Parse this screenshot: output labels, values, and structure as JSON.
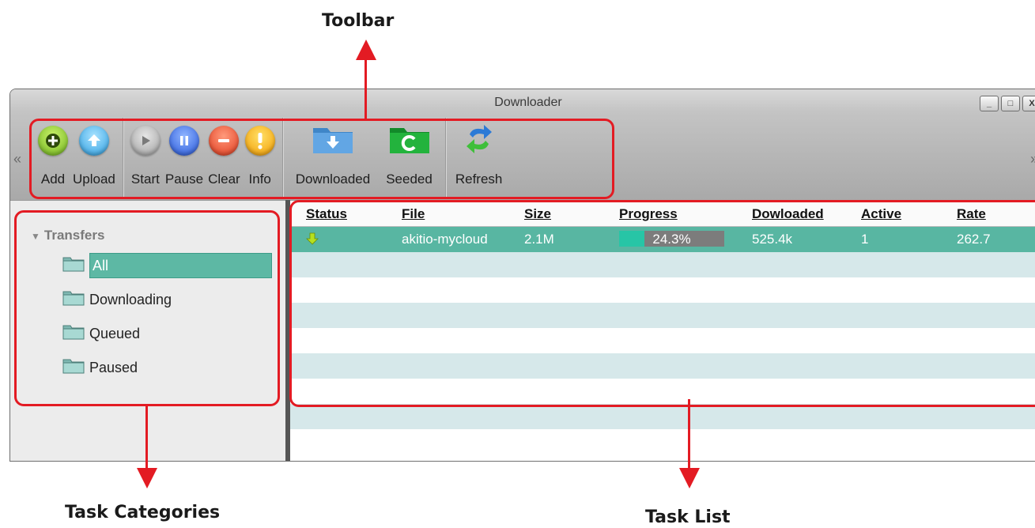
{
  "annotations": {
    "toolbar": "Toolbar",
    "task_categories": "Task Categories",
    "task_list": "Task List"
  },
  "window": {
    "title": "Downloader",
    "scroll_left": "«",
    "scroll_right": "»",
    "controls": {
      "minimize": "_",
      "maximize": "□",
      "close": "X"
    }
  },
  "toolbar": {
    "add": "Add",
    "upload": "Upload",
    "start": "Start",
    "pause": "Pause",
    "clear": "Clear",
    "info": "Info",
    "downloaded": "Downloaded",
    "seeded": "Seeded",
    "refresh": "Refresh"
  },
  "categories": {
    "root": "Transfers",
    "items": [
      "All",
      "Downloading",
      "Queued",
      "Paused"
    ],
    "selected": "All"
  },
  "task_list": {
    "columns": [
      "Status",
      "File",
      "Size",
      "Progress",
      "Dowloaded",
      "Active",
      "Rate"
    ],
    "rows": [
      {
        "status_icon": "down-arrow-icon",
        "file": "akitio-mycloud",
        "size": "2.1M",
        "progress": "24.3%",
        "progress_value": 0.243,
        "downloaded": "525.4k",
        "active": "1",
        "rate": "262.7"
      }
    ]
  },
  "colors": {
    "highlight": "#e31b23",
    "selection": "#58b6a2",
    "stripe": "#d6e8ea",
    "progress_fill": "#27c5a6"
  }
}
